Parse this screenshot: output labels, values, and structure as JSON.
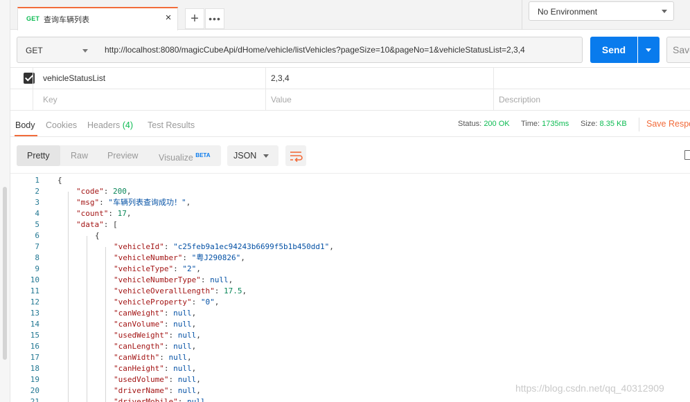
{
  "tab": {
    "method": "GET",
    "title": "查询车辆列表",
    "close": "×"
  },
  "tab_actions": {
    "add": "+",
    "more": "•••"
  },
  "environment": {
    "selected": "No Environment"
  },
  "request": {
    "method": "GET",
    "url": "http://localhost:8080/magicCubeApi/dHome/vehicle/listVehicles?pageSize=10&pageNo=1&vehicleStatusList=2,3,4",
    "send_label": "Send",
    "save_label": "Save"
  },
  "params": {
    "rows": [
      {
        "key": "vehicleStatusList",
        "value": "2,3,4",
        "checked": true
      }
    ],
    "placeholder": {
      "key": "Key",
      "value": "Value",
      "description": "Description"
    }
  },
  "response_tabs": {
    "body": "Body",
    "cookies": "Cookies",
    "headers": "Headers",
    "headers_count": "(4)",
    "test_results": "Test Results"
  },
  "response_status": {
    "status_label": "Status:",
    "status_value": "200 OK",
    "time_label": "Time:",
    "time_value": "1735ms",
    "size_label": "Size:",
    "size_value": "8.35 KB",
    "save_response": "Save Response"
  },
  "view_modes": {
    "pretty": "Pretty",
    "raw": "Raw",
    "preview": "Preview",
    "visualize": "Visualize",
    "beta": "BETA"
  },
  "format": {
    "selected": "JSON"
  },
  "code_lines": [
    {
      "n": "1",
      "indent": 0,
      "parts": [
        {
          "t": "p",
          "v": "{"
        }
      ]
    },
    {
      "n": "2",
      "indent": 1,
      "parts": [
        {
          "t": "k",
          "v": "\"code\""
        },
        {
          "t": "p",
          "v": ": "
        },
        {
          "t": "n",
          "v": "200"
        },
        {
          "t": "p",
          "v": ","
        }
      ]
    },
    {
      "n": "3",
      "indent": 1,
      "parts": [
        {
          "t": "k",
          "v": "\"msg\""
        },
        {
          "t": "p",
          "v": ": "
        },
        {
          "t": "s",
          "v": "\"车辆列表查询成功！\""
        },
        {
          "t": "p",
          "v": ","
        }
      ]
    },
    {
      "n": "4",
      "indent": 1,
      "parts": [
        {
          "t": "k",
          "v": "\"count\""
        },
        {
          "t": "p",
          "v": ": "
        },
        {
          "t": "n",
          "v": "17"
        },
        {
          "t": "p",
          "v": ","
        }
      ]
    },
    {
      "n": "5",
      "indent": 1,
      "parts": [
        {
          "t": "k",
          "v": "\"data\""
        },
        {
          "t": "p",
          "v": ": ["
        }
      ]
    },
    {
      "n": "6",
      "indent": 2,
      "parts": [
        {
          "t": "p",
          "v": "{"
        }
      ]
    },
    {
      "n": "7",
      "indent": 3,
      "parts": [
        {
          "t": "k",
          "v": "\"vehicleId\""
        },
        {
          "t": "p",
          "v": ": "
        },
        {
          "t": "s",
          "v": "\"c25feb9a1ec94243b6699f5b1b450dd1\""
        },
        {
          "t": "p",
          "v": ","
        }
      ]
    },
    {
      "n": "8",
      "indent": 3,
      "parts": [
        {
          "t": "k",
          "v": "\"vehicleNumber\""
        },
        {
          "t": "p",
          "v": ": "
        },
        {
          "t": "s",
          "v": "\"粤J290826\""
        },
        {
          "t": "p",
          "v": ","
        }
      ]
    },
    {
      "n": "9",
      "indent": 3,
      "parts": [
        {
          "t": "k",
          "v": "\"vehicleType\""
        },
        {
          "t": "p",
          "v": ": "
        },
        {
          "t": "s",
          "v": "\"2\""
        },
        {
          "t": "p",
          "v": ","
        }
      ]
    },
    {
      "n": "10",
      "indent": 3,
      "parts": [
        {
          "t": "k",
          "v": "\"vehicleNumberType\""
        },
        {
          "t": "p",
          "v": ": "
        },
        {
          "t": "s",
          "v": "null"
        },
        {
          "t": "p",
          "v": ","
        }
      ]
    },
    {
      "n": "11",
      "indent": 3,
      "parts": [
        {
          "t": "k",
          "v": "\"vehicleOverallLength\""
        },
        {
          "t": "p",
          "v": ": "
        },
        {
          "t": "n",
          "v": "17.5"
        },
        {
          "t": "p",
          "v": ","
        }
      ]
    },
    {
      "n": "12",
      "indent": 3,
      "parts": [
        {
          "t": "k",
          "v": "\"vehicleProperty\""
        },
        {
          "t": "p",
          "v": ": "
        },
        {
          "t": "s",
          "v": "\"0\""
        },
        {
          "t": "p",
          "v": ","
        }
      ]
    },
    {
      "n": "13",
      "indent": 3,
      "parts": [
        {
          "t": "k",
          "v": "\"canWeight\""
        },
        {
          "t": "p",
          "v": ": "
        },
        {
          "t": "s",
          "v": "null"
        },
        {
          "t": "p",
          "v": ","
        }
      ]
    },
    {
      "n": "14",
      "indent": 3,
      "parts": [
        {
          "t": "k",
          "v": "\"canVolume\""
        },
        {
          "t": "p",
          "v": ": "
        },
        {
          "t": "s",
          "v": "null"
        },
        {
          "t": "p",
          "v": ","
        }
      ]
    },
    {
      "n": "15",
      "indent": 3,
      "parts": [
        {
          "t": "k",
          "v": "\"usedWeight\""
        },
        {
          "t": "p",
          "v": ": "
        },
        {
          "t": "s",
          "v": "null"
        },
        {
          "t": "p",
          "v": ","
        }
      ]
    },
    {
      "n": "16",
      "indent": 3,
      "parts": [
        {
          "t": "k",
          "v": "\"canLength\""
        },
        {
          "t": "p",
          "v": ": "
        },
        {
          "t": "s",
          "v": "null"
        },
        {
          "t": "p",
          "v": ","
        }
      ]
    },
    {
      "n": "17",
      "indent": 3,
      "parts": [
        {
          "t": "k",
          "v": "\"canWidth\""
        },
        {
          "t": "p",
          "v": ": "
        },
        {
          "t": "s",
          "v": "null"
        },
        {
          "t": "p",
          "v": ","
        }
      ]
    },
    {
      "n": "18",
      "indent": 3,
      "parts": [
        {
          "t": "k",
          "v": "\"canHeight\""
        },
        {
          "t": "p",
          "v": ": "
        },
        {
          "t": "s",
          "v": "null"
        },
        {
          "t": "p",
          "v": ","
        }
      ]
    },
    {
      "n": "19",
      "indent": 3,
      "parts": [
        {
          "t": "k",
          "v": "\"usedVolume\""
        },
        {
          "t": "p",
          "v": ": "
        },
        {
          "t": "s",
          "v": "null"
        },
        {
          "t": "p",
          "v": ","
        }
      ]
    },
    {
      "n": "20",
      "indent": 3,
      "parts": [
        {
          "t": "k",
          "v": "\"driverName\""
        },
        {
          "t": "p",
          "v": ": "
        },
        {
          "t": "s",
          "v": "null"
        },
        {
          "t": "p",
          "v": ","
        }
      ]
    },
    {
      "n": "21",
      "indent": 3,
      "parts": [
        {
          "t": "k",
          "v": "\"driverMobile\""
        },
        {
          "t": "p",
          "v": ": "
        },
        {
          "t": "s",
          "v": "null"
        }
      ]
    }
  ],
  "watermark": "https://blog.csdn.net/qq_40312909",
  "colors": {
    "accent": "#f26b3a",
    "send": "#097bed",
    "success": "#0cbb52"
  },
  "icons": {
    "wrap": "wrap-lines-icon",
    "copy": "copy-icon"
  }
}
